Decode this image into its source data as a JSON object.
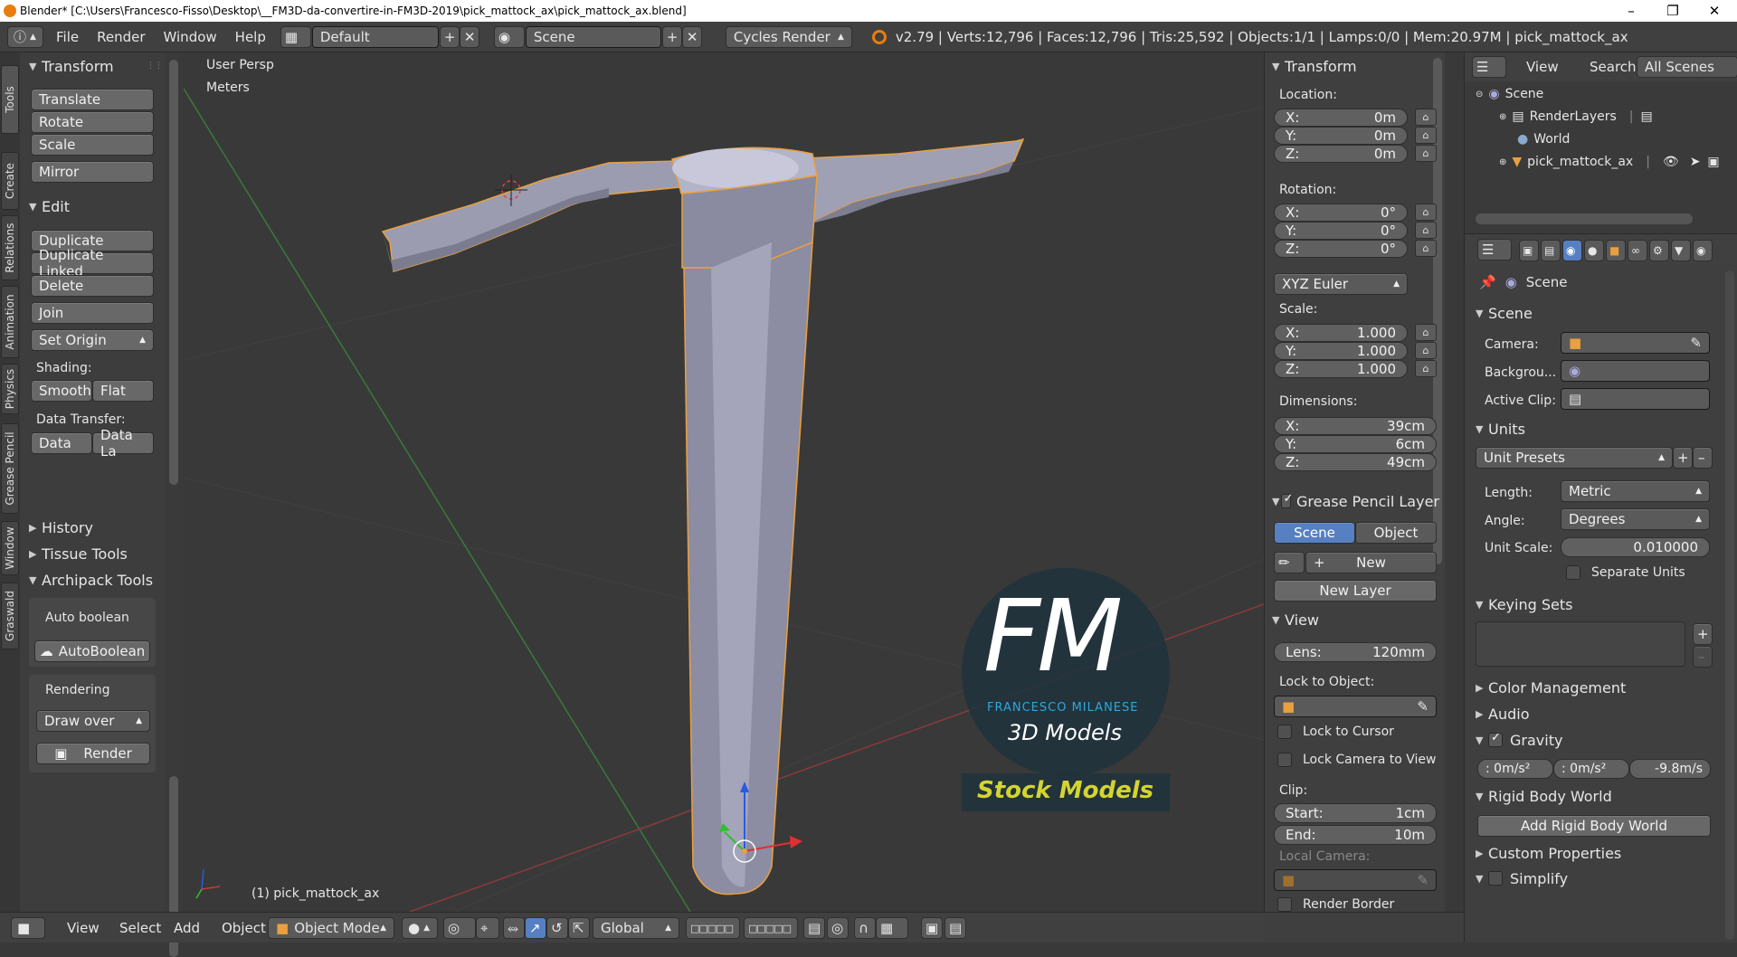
{
  "titlebar": {
    "title": "Blender* [C:\\Users\\Francesco-Fisso\\Desktop\\__FM3D-da-convertire-in-FM3D-2019\\pick_mattock_ax\\pick_mattock_ax.blend]"
  },
  "infobar": {
    "menus": [
      "File",
      "Render",
      "Window",
      "Help"
    ],
    "layout": "Default",
    "scene": "Scene",
    "engine": "Cycles Render",
    "stats": "v2.79 | Verts:12,796 | Faces:12,796 | Tris:25,592 | Objects:1/1 | Lamps:0/0 | Mem:20.97M | pick_mattock_ax"
  },
  "left_tabs": [
    "Tools",
    "Create",
    "Relations",
    "Animation",
    "Physics",
    "Grease Pencil",
    "Window",
    "Graswald"
  ],
  "tools": {
    "transform_header": "Transform",
    "translate": "Translate",
    "rotate": "Rotate",
    "scale": "Scale",
    "mirror": "Mirror",
    "edit_header": "Edit",
    "duplicate": "Duplicate",
    "duplicate_linked": "Duplicate Linked",
    "delete": "Delete",
    "join": "Join",
    "set_origin": "Set Origin",
    "shading_label": "Shading:",
    "smooth": "Smooth",
    "flat": "Flat",
    "data_transfer_label": "Data Transfer:",
    "data": "Data",
    "data_la": "Data La",
    "history": "History",
    "tissue_tools": "Tissue Tools",
    "archipack": "Archipack Tools",
    "auto_boolean_label": "Auto boolean",
    "autoboolean_btn": "AutoBoolean",
    "rendering_label": "Rendering",
    "draw_over": "Draw over",
    "render_btn": "Render"
  },
  "viewport": {
    "persp": "User Persp",
    "units": "Meters",
    "object_label": "(1) pick_mattock_ax",
    "watermark_fm": "FM",
    "watermark_name": "FRANCESCO MILANESE",
    "watermark_3d": "3D Models",
    "watermark_stock": "Stock Models"
  },
  "props_n": {
    "transform_header": "Transform",
    "location_label": "Location:",
    "loc": [
      {
        "l": "X:",
        "v": "0m"
      },
      {
        "l": "Y:",
        "v": "0m"
      },
      {
        "l": "Z:",
        "v": "0m"
      }
    ],
    "rotation_label": "Rotation:",
    "rot": [
      {
        "l": "X:",
        "v": "0°"
      },
      {
        "l": "Y:",
        "v": "0°"
      },
      {
        "l": "Z:",
        "v": "0°"
      }
    ],
    "euler": "XYZ Euler",
    "scale_label": "Scale:",
    "scl": [
      {
        "l": "X:",
        "v": "1.000"
      },
      {
        "l": "Y:",
        "v": "1.000"
      },
      {
        "l": "Z:",
        "v": "1.000"
      }
    ],
    "dimensions_label": "Dimensions:",
    "dim": [
      {
        "l": "X:",
        "v": "39cm"
      },
      {
        "l": "Y:",
        "v": "6cm"
      },
      {
        "l": "Z:",
        "v": "49cm"
      }
    ],
    "gp_header": "Grease Pencil Layer",
    "gp_scene": "Scene",
    "gp_object": "Object",
    "gp_new": "New",
    "gp_new_layer": "New Layer",
    "view_header": "View",
    "lens_label": "Lens:",
    "lens_value": "120mm",
    "lock_to_object": "Lock to Object:",
    "lock_to_cursor": "Lock to Cursor",
    "lock_camera": "Lock Camera to View",
    "clip_label": "Clip:",
    "clip_start_l": "Start:",
    "clip_start_v": "1cm",
    "clip_end_l": "End:",
    "clip_end_v": "10m",
    "local_camera": "Local Camera:",
    "render_border": "Render Border"
  },
  "outliner": {
    "view": "View",
    "search": "Search",
    "filter": "All Scenes",
    "items": [
      "Scene",
      "RenderLayers",
      "World",
      "pick_mattock_ax"
    ]
  },
  "properties": {
    "context": "Scene",
    "scene_header": "Scene",
    "camera_label": "Camera:",
    "background_label": "Backgrou...",
    "active_clip_label": "Active Clip:",
    "units_header": "Units",
    "unit_presets": "Unit Presets",
    "length_label": "Length:",
    "length_value": "Metric",
    "angle_label": "Angle:",
    "angle_value": "Degrees",
    "unit_scale_label": "Unit Scale:",
    "unit_scale_value": "0.010000",
    "separate_units": "Separate Units",
    "keying_sets": "Keying Sets",
    "color_management": "Color Management",
    "audio": "Audio",
    "gravity": "Gravity",
    "gravity_values": [
      ": 0m/s²",
      ": 0m/s²",
      "-9.8m/s"
    ],
    "rigid_body_world": "Rigid Body World",
    "add_rigid_body_world": "Add Rigid Body World",
    "custom_properties": "Custom Properties",
    "simplify": "Simplify"
  },
  "bottom": {
    "view": "View",
    "select": "Select",
    "add": "Add",
    "object": "Object",
    "mode": "Object Mode",
    "orientation": "Global"
  },
  "colors": {
    "accent_blue": "#5680c2",
    "selection_orange": "#e8a040",
    "brand_cyan": "#2aa8e0",
    "stock_yellow": "#d4d431"
  }
}
